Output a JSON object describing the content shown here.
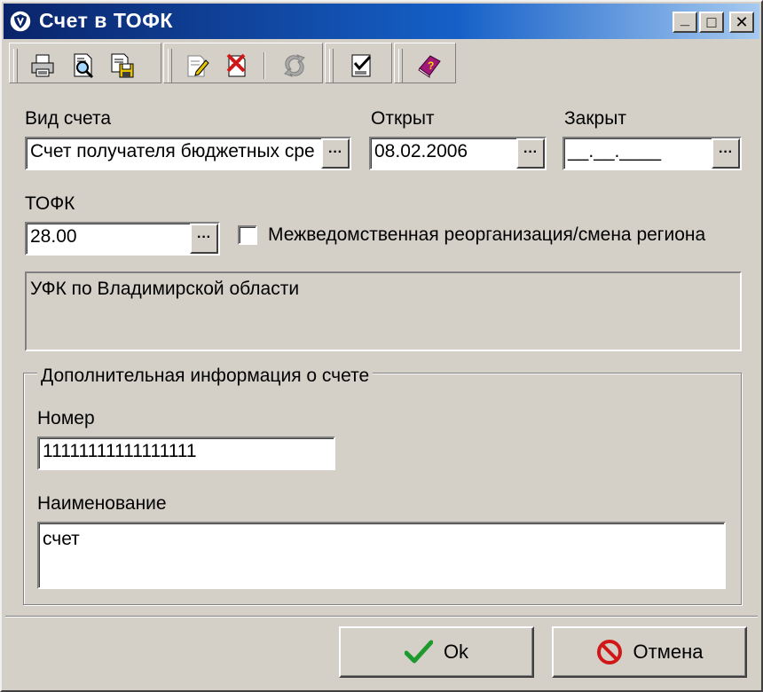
{
  "window": {
    "title": "Счет в ТОФК",
    "minimize_glyph": "_",
    "maximize_glyph": "□",
    "close_glyph": "✕"
  },
  "toolbar": {
    "icons": [
      "print-icon",
      "preview-icon",
      "save-icon",
      "edit-icon",
      "delete-icon",
      "refresh-icon",
      "document-check-icon",
      "help-book-icon"
    ]
  },
  "form": {
    "account_type": {
      "label": "Вид счета",
      "value": "Счет получателя бюджетных сре"
    },
    "opened": {
      "label": "Открыт",
      "value": "08.02.2006"
    },
    "closed": {
      "label": "Закрыт",
      "value": "__.__.____"
    },
    "tofk": {
      "label": "ТОФК",
      "value": "28.00"
    },
    "reorg_checkbox": {
      "label": "Межведомственная реорганизация/смена региона",
      "checked": false
    },
    "tofk_name": "УФК по Владимирской области",
    "extra_group": {
      "title": "Дополнительная информация о счете",
      "number_label": "Номер",
      "number_value": "11111111111111111",
      "name_label": "Наименование",
      "name_value": "счет"
    },
    "ellipsis_label": "···"
  },
  "buttons": {
    "ok": "Ok",
    "cancel": "Отмена"
  },
  "colors": {
    "titlebar_start": "#0a246a",
    "titlebar_end": "#a6caf0",
    "face": "#d4d0c8",
    "ok_check": "#1e9a2c",
    "cancel_red": "#d01818"
  }
}
